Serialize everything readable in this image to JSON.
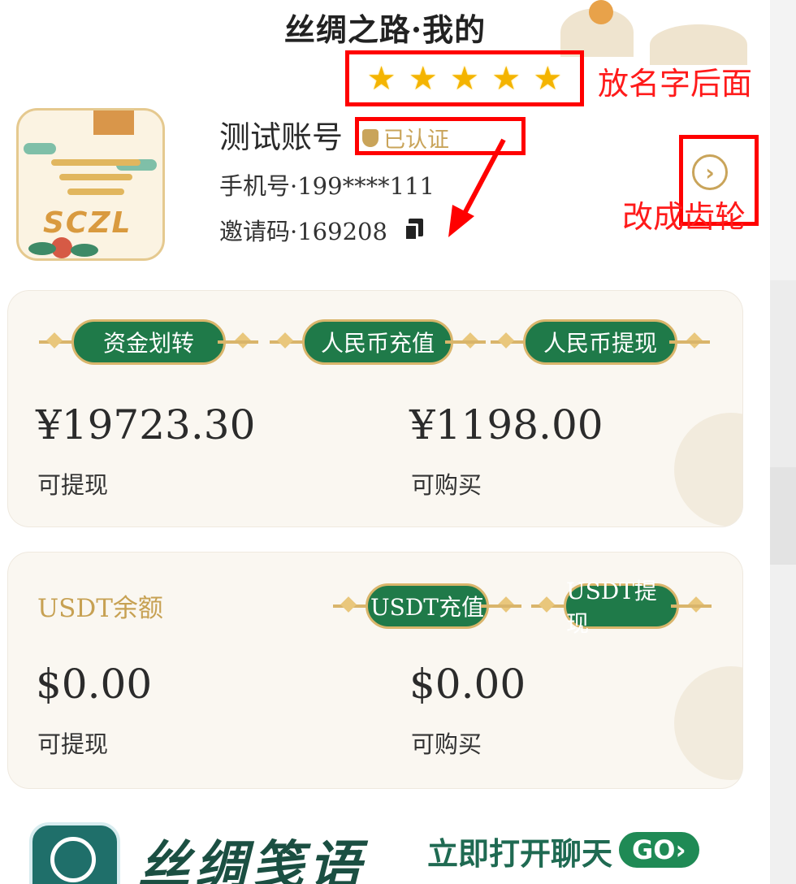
{
  "header": {
    "title": "丝绸之路·我的"
  },
  "profile": {
    "avatar_logo_text": "SCZL",
    "stars": [
      "★",
      "★",
      "★",
      "★",
      "★"
    ],
    "name": "测试账号",
    "verified_label": "已认证",
    "phone": "手机号·199****111",
    "invite": "邀请码·169208",
    "chevron": "›"
  },
  "annotations": {
    "stars_note": "放名字后面",
    "gear_note": "改成齿轮"
  },
  "rmb_card": {
    "buttons": [
      "资金划转",
      "人民币充值",
      "人民币提现"
    ],
    "withdrawable_amount": "¥19723.30",
    "withdrawable_label": "可提现",
    "purchasable_amount": "¥1198.00",
    "purchasable_label": "可购买"
  },
  "usdt_card": {
    "title": "USDT余额",
    "buttons": [
      "USDT充值",
      "USDT提现"
    ],
    "withdrawable_amount": "$0.00",
    "withdrawable_label": "可提现",
    "purchasable_amount": "$0.00",
    "purchasable_label": "可购买"
  },
  "banner": {
    "brand": "丝绸笺语",
    "chat_label": "立即打开聊天",
    "go_label": "GO›"
  },
  "colors": {
    "annotation_red": "#ff0000",
    "button_green": "#1f7a49",
    "gold": "#c9a45a"
  }
}
